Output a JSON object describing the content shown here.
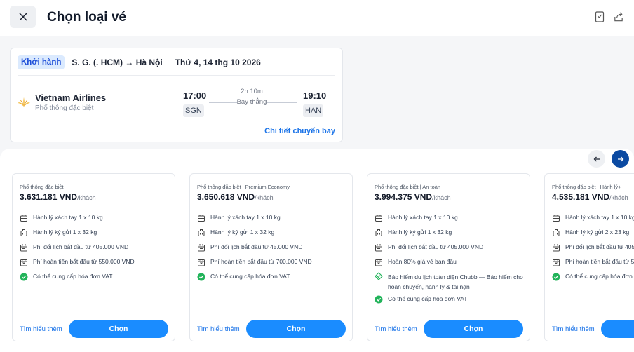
{
  "header": {
    "title": "Chọn loại vé"
  },
  "flight": {
    "depart_badge": "Khởi hành",
    "route": "S. G. (. HCM) → Hà Nội",
    "date": "Thứ 4, 14 thg 10 2026",
    "airline": "Vietnam Airlines",
    "fare_class": "Phổ thông đặc biệt",
    "dep_time": "17:00",
    "dep_code": "SGN",
    "arr_time": "19:10",
    "arr_code": "HAN",
    "duration": "2h 10m",
    "direct": "Bay thẳng",
    "details_link": "Chi tiết chuyến bay"
  },
  "fares": [
    {
      "name": "Phổ thông đặc biệt",
      "price": "3.631.181 VND",
      "unit": "/khách",
      "features": [
        {
          "icon": "carry-on-bag-icon",
          "text": "Hành lý xách tay 1 x 10 kg"
        },
        {
          "icon": "checked-bag-icon",
          "text": "Hành lý ký gửi 1 x 32 kg"
        },
        {
          "icon": "calendar-change-icon",
          "text": "Phí đổi lịch bắt đầu từ 405.000 VND"
        },
        {
          "icon": "refund-icon",
          "text": "Phí hoàn tiền bắt đầu từ 550.000 VND"
        },
        {
          "icon": "check-circle-icon",
          "text": "Có thể cung cấp hóa đơn VAT"
        }
      ],
      "learn_more": "Tìm hiểu thêm",
      "choose": "Chọn"
    },
    {
      "name": "Phổ thông đặc biệt | Premium Economy",
      "price": "3.650.618 VND",
      "unit": "/khách",
      "features": [
        {
          "icon": "carry-on-bag-icon",
          "text": "Hành lý xách tay 1 x 10 kg"
        },
        {
          "icon": "checked-bag-icon",
          "text": "Hành lý ký gửi 1 x 32 kg"
        },
        {
          "icon": "calendar-change-icon",
          "text": "Phí đổi lịch bắt đầu từ 45.000 VND"
        },
        {
          "icon": "refund-icon",
          "text": "Phí hoàn tiền bắt đầu từ 700.000 VND"
        },
        {
          "icon": "check-circle-icon",
          "text": "Có thể cung cấp hóa đơn VAT"
        }
      ],
      "learn_more": "Tìm hiểu thêm",
      "choose": "Chọn"
    },
    {
      "name": "Phổ thông đặc biệt | An toàn",
      "price": "3.994.375 VND",
      "unit": "/khách",
      "features": [
        {
          "icon": "carry-on-bag-icon",
          "text": "Hành lý xách tay 1 x 10 kg"
        },
        {
          "icon": "checked-bag-icon",
          "text": "Hành lý ký gửi 1 x 32 kg"
        },
        {
          "icon": "calendar-change-icon",
          "text": "Phí đổi lịch bắt đầu từ 405.000 VND"
        },
        {
          "icon": "refund-icon",
          "text": "Hoàn 80% giá vé ban đầu"
        },
        {
          "icon": "insurance-icon",
          "text": "Bảo hiểm du lịch toàn diện Chubb — Bảo hiểm cho hoãn chuyến, hành lý & tai nạn"
        },
        {
          "icon": "check-circle-icon",
          "text": "Có thể cung cấp hóa đơn VAT"
        }
      ],
      "learn_more": "Tìm hiểu thêm",
      "choose": "Chọn"
    },
    {
      "name": "Phổ thông đặc biệt | Hành lý+",
      "price": "4.535.181 VND",
      "unit": "/khách",
      "features": [
        {
          "icon": "carry-on-bag-icon",
          "text": "Hành lý xách tay 1 x 10 kg"
        },
        {
          "icon": "checked-bag-icon",
          "text": "Hành lý ký gửi 2 x 23 kg"
        },
        {
          "icon": "calendar-change-icon",
          "text": "Phí đổi lịch bắt đầu từ 405.000 VND"
        },
        {
          "icon": "refund-icon",
          "text": "Phí hoàn tiền bắt đầu từ 550.000 VND"
        },
        {
          "icon": "check-circle-icon",
          "text": "Có thể cung cấp hóa đơn VAT"
        }
      ],
      "learn_more": "Tìm hiểu thêm",
      "choose": "Chọn"
    }
  ],
  "colors": {
    "accent": "#1a8cff",
    "link": "#1a73e8",
    "check": "#22b35a",
    "nav_active": "#0b4aa2"
  }
}
